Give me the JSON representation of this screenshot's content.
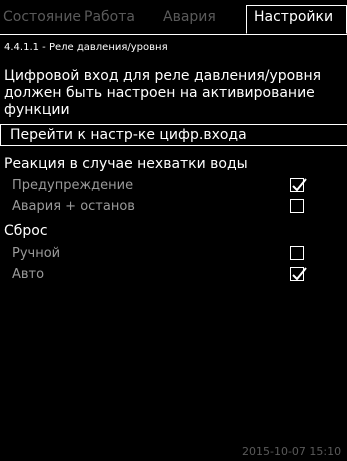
{
  "tabs": [
    {
      "label": "Состояние",
      "active": false
    },
    {
      "label": "Работа",
      "active": false
    },
    {
      "label": "Авария",
      "active": false
    },
    {
      "label": "Настройки",
      "active": true
    }
  ],
  "breadcrumb": "4.4.1.1 - Реле давления/уровня",
  "info_lines": [
    "Цифровой вход для реле давления/уровня",
    "должен быть настроен на активирование",
    "функции"
  ],
  "goto_button": "Перейти к настр-ке цифр.входа",
  "reaction": {
    "title": "Реакция в случае нехватки воды",
    "options": [
      {
        "label": "Предупреждение",
        "checked": true
      },
      {
        "label": "Авария + останов",
        "checked": false
      }
    ]
  },
  "reset": {
    "title": "Сброс",
    "options": [
      {
        "label": "Ручной",
        "checked": false
      },
      {
        "label": "Авто",
        "checked": true
      }
    ]
  },
  "datetime": "2015-10-07 15:10",
  "icons": {
    "check": "check-icon"
  },
  "colors": {
    "background": "#000000",
    "text": "#ffffff",
    "inactive": "#5a5a5a",
    "option_text": "#9a9a9a"
  }
}
